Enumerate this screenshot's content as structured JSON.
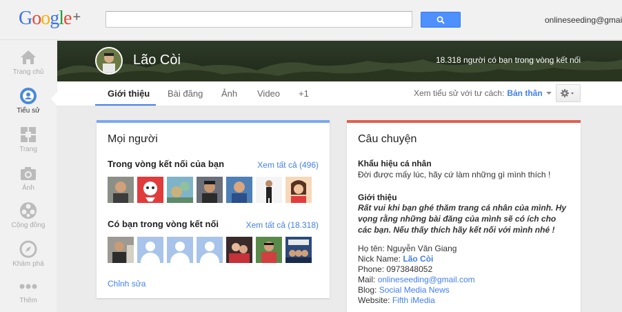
{
  "header": {
    "logo": {
      "G": "G",
      "o1": "o",
      "o2": "o",
      "g": "g",
      "l": "l",
      "e": "e",
      "plus": "+"
    },
    "search": {
      "value": "",
      "placeholder": ""
    },
    "account_email": "onlineseeding@gmail.com"
  },
  "colors": {
    "accent": "#427fed",
    "search_button": "#4d90fe",
    "people_card": "#7aa8f3",
    "story_card": "#e0604f"
  },
  "leftnav": {
    "items": [
      {
        "label": "Trang chủ",
        "icon": "home-icon"
      },
      {
        "label": "Tiểu sử",
        "icon": "profile-icon",
        "active": true
      },
      {
        "label": "Trang",
        "icon": "pages-icon"
      },
      {
        "label": "Ảnh",
        "icon": "camera-icon"
      },
      {
        "label": "Cộng đồng",
        "icon": "communities-icon"
      },
      {
        "label": "Khám phá",
        "icon": "explore-icon"
      },
      {
        "label": "Thêm",
        "icon": "more-icon"
      }
    ]
  },
  "profile": {
    "name": "Lão Còi",
    "circles_count": "18.318 người có bạn trong vòng kết nối"
  },
  "tabs": [
    {
      "label": "Giới thiệu",
      "active": true
    },
    {
      "label": "Bài đăng"
    },
    {
      "label": "Ảnh"
    },
    {
      "label": "Video"
    },
    {
      "label": "+1"
    }
  ],
  "view_as": {
    "label": "Xem tiểu sử với tư cách:",
    "value": "Bản thân"
  },
  "people_card": {
    "title": "Mọi người",
    "in_circles": {
      "title": "Trong vòng kết nối của bạn",
      "see_all": "Xem tất cả (496)"
    },
    "have_you": {
      "title": "Có bạn trong vòng kết nối",
      "see_all": "Xem tất cả (18.318)"
    },
    "edit": "Chỉnh sửa"
  },
  "story_card": {
    "title": "Câu chuyện",
    "tagline_title": "Khẩu hiệu cá nhân",
    "tagline": "Đời được mấy lúc, hãy cứ làm những gì mình thích !",
    "intro_title": "Giới thiệu",
    "intro": "Rất vui khi bạn ghé thăm trang cá nhân của mình. Hy vọng rằng những bài đăng của mình sẽ có ích cho các bạn. Nếu thấy thích hãy kết nối với mình nhé !",
    "fullname_label": "Họ tên:",
    "fullname": "Nguyễn Văn Giang",
    "nick_label": "Nick Name:",
    "nick": "Lão Còi",
    "phone_label": "Phone:",
    "phone": "0973848052",
    "mail_label": "Mail:",
    "mail": "onlineseeding@gmail.com",
    "blog_label": "Blog:",
    "blog": "Social Media News",
    "website_label": "Website:",
    "website": "Fifth iMedia"
  }
}
